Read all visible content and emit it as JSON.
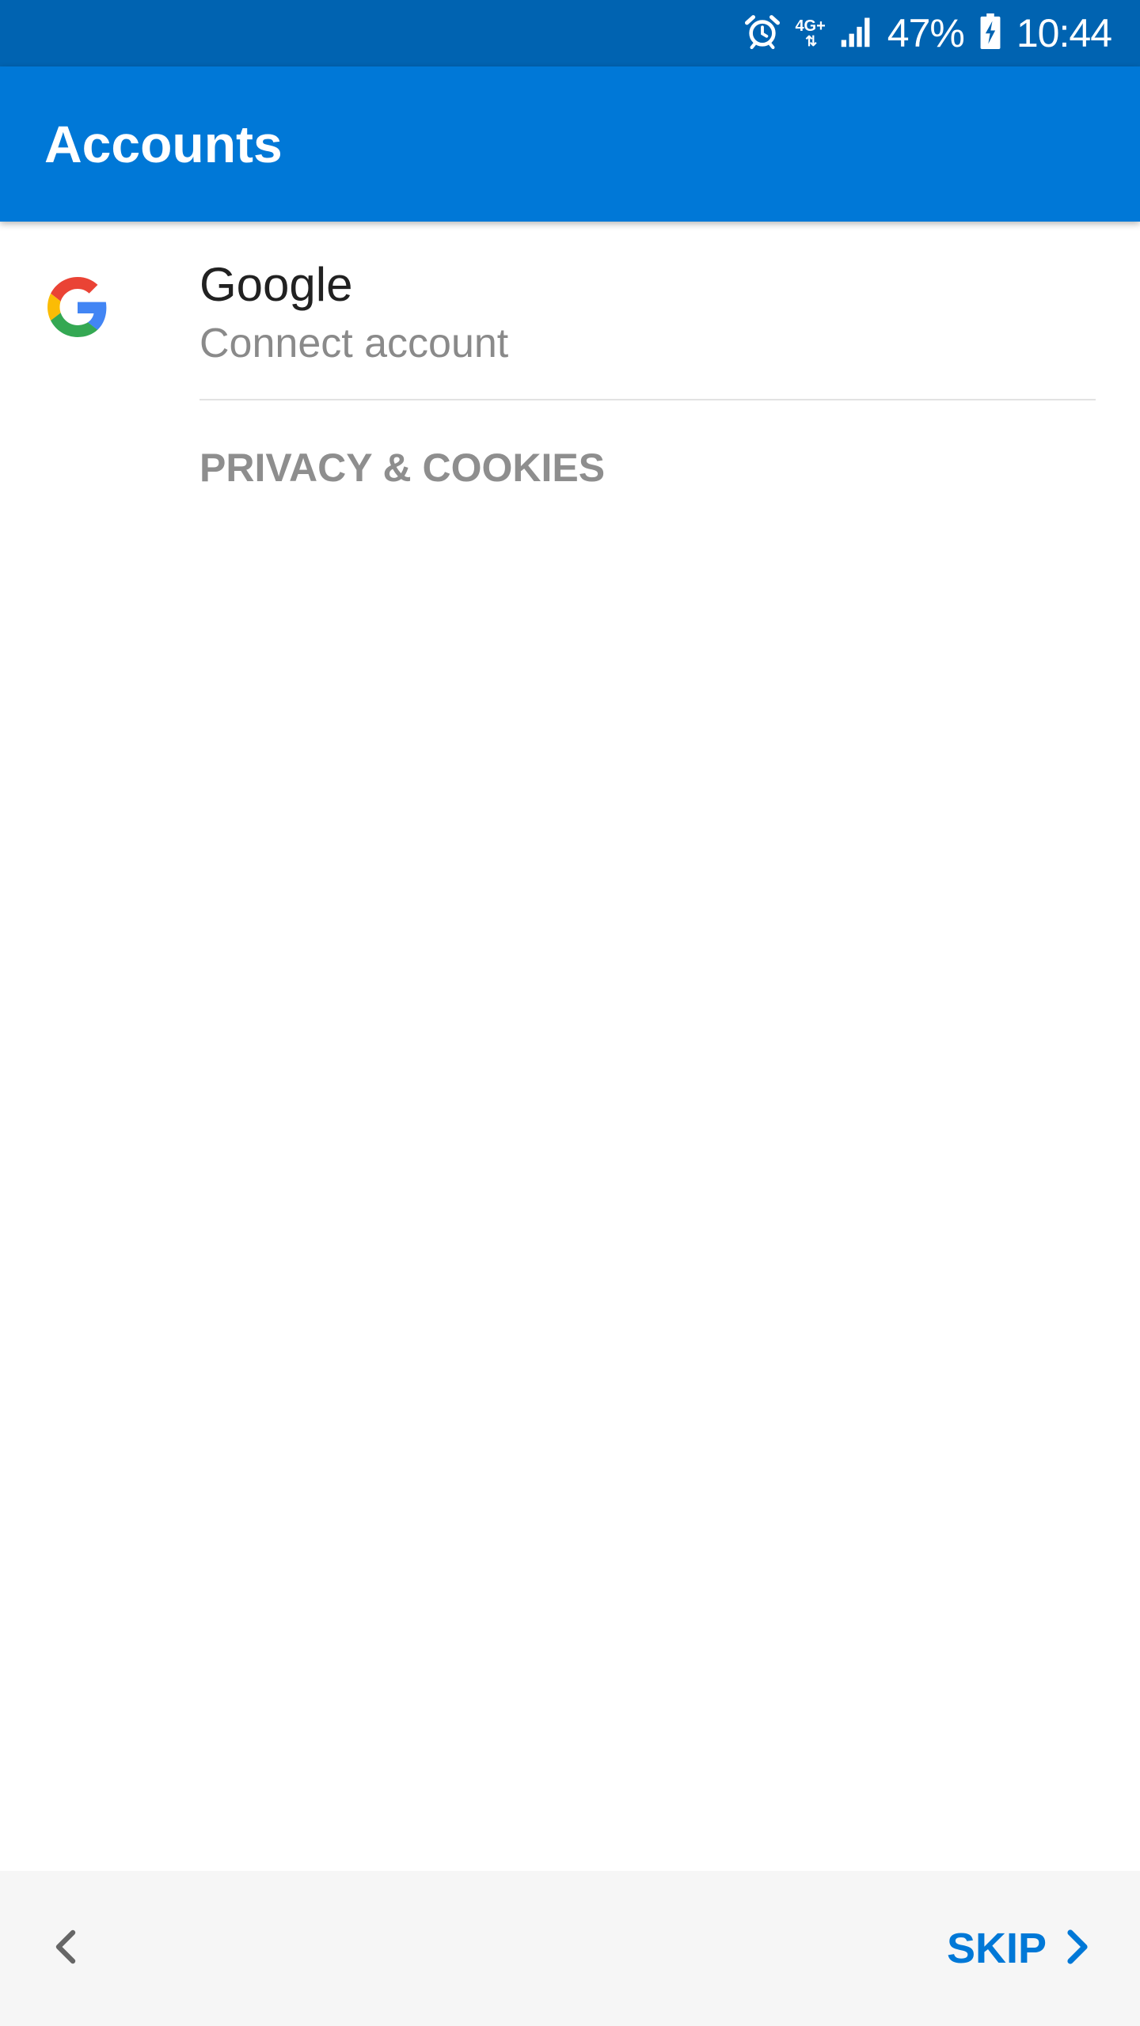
{
  "status_bar": {
    "network_type": "4G+",
    "network_arrows": "⇅",
    "battery_percent": "47%",
    "time": "10:44",
    "icons": [
      "alarm-icon",
      "network-4g-icon",
      "signal-icon",
      "battery-charging-icon"
    ]
  },
  "app_bar": {
    "title": "Accounts"
  },
  "account": {
    "name": "Google",
    "subtitle": "Connect account",
    "icon": "google-logo-icon"
  },
  "privacy_link": "PRIVACY & COOKIES",
  "bottom_bar": {
    "back_icon": "chevron-left-icon",
    "skip_label": "SKIP",
    "skip_icon": "chevron-right-icon"
  },
  "colors": {
    "status_bar": "#0063b1",
    "app_bar": "#0078d7",
    "accent": "#0078d7",
    "bottom_bar": "#f6f6f6",
    "google_blue": "#4285F4",
    "google_green": "#34A853",
    "google_yellow": "#FBBC05",
    "google_red": "#EA4335"
  }
}
